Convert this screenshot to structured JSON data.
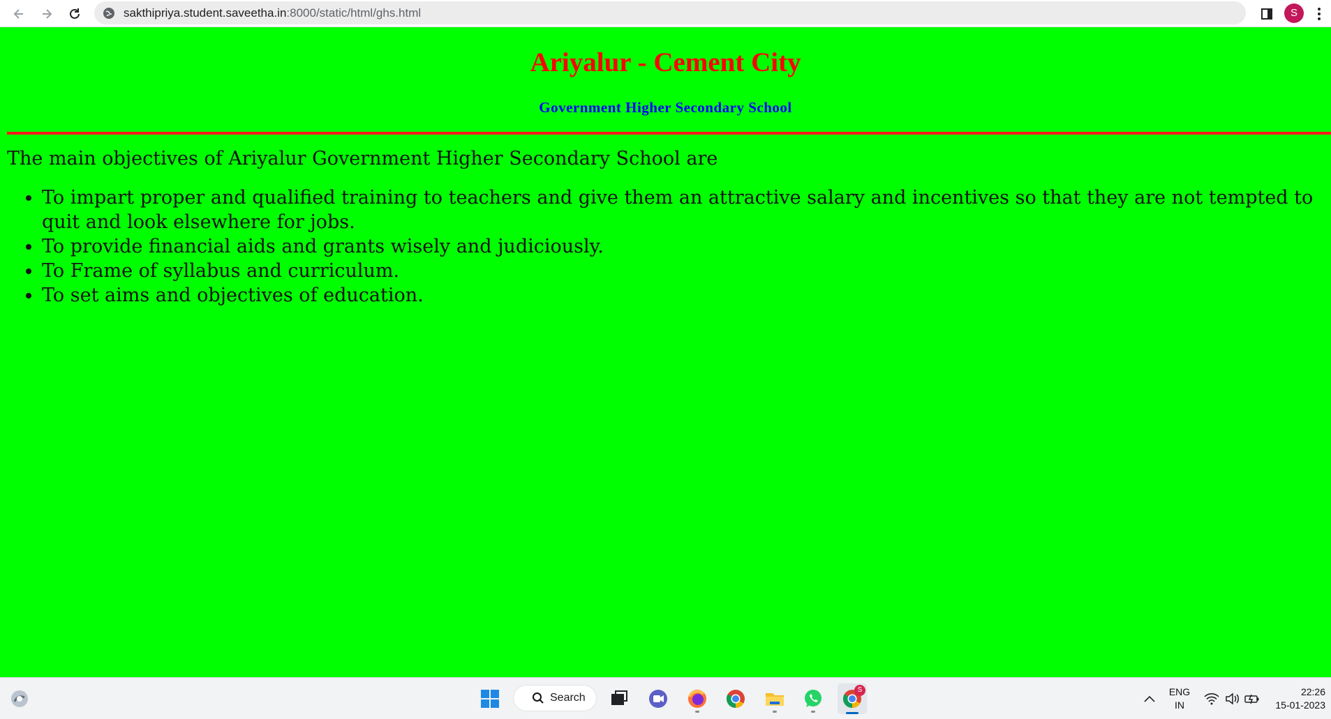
{
  "browser": {
    "url_host": "sakthipriya.student.saveetha.in",
    "url_path": ":8000/static/html/ghs.html",
    "profile_initial": "S"
  },
  "page": {
    "title": "Ariyalur - Cement City",
    "subtitle": "Government Higher Secondary School",
    "intro": "The main objectives of Ariyalur Government Higher Secondary School are",
    "objectives": [
      "To impart proper and qualified training to teachers and give them an attractive salary and incentives so that they are not tempted to quit and look elsewhere for jobs.",
      "To provide financial aids and grants wisely and judiciously.",
      "To Frame of syllabus and curriculum.",
      "To set aims and objectives of education."
    ],
    "colors": {
      "background": "#00ff00",
      "title": "#ff0000",
      "subtitle": "#0000ff",
      "rule": "#ff1a1a"
    }
  },
  "taskbar": {
    "search_label": "Search",
    "chrome_badge": "S",
    "language_line1": "ENG",
    "language_line2": "IN",
    "time": "22:26",
    "date": "15-01-2023",
    "apps": [
      "start-icon",
      "task-view-icon",
      "teams-chat-icon",
      "firefox-icon",
      "chrome-icon",
      "file-explorer-icon",
      "whatsapp-icon",
      "chrome-profile-icon"
    ]
  }
}
